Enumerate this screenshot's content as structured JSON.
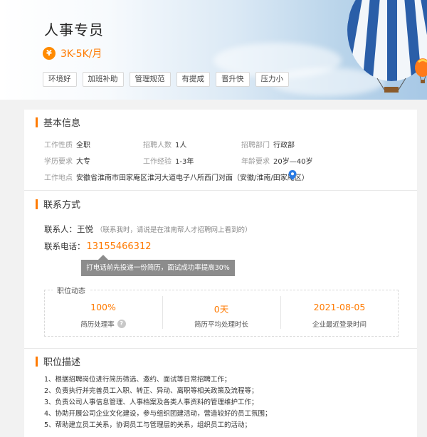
{
  "header": {
    "title": "人事专员",
    "salary_symbol": "¥",
    "salary": "3K-5K/月",
    "tags": [
      "环境好",
      "加班补助",
      "管理规范",
      "有提成",
      "晋升快",
      "压力小"
    ]
  },
  "basic_info": {
    "title": "基本信息",
    "fields": [
      {
        "label": "工作性质",
        "value": "全职"
      },
      {
        "label": "招聘人数",
        "value": "1人"
      },
      {
        "label": "招聘部门",
        "value": "行政部"
      },
      {
        "label": "学历要求",
        "value": "大专"
      },
      {
        "label": "工作经验",
        "value": "1-3年"
      },
      {
        "label": "年龄要求",
        "value": "20岁—40岁"
      }
    ],
    "location_label": "工作地点",
    "location_value": "安徽省淮南市田家庵区淮河大道电子八所西门对面（安徽/淮南/田家庵区）"
  },
  "contact": {
    "title": "联系方式",
    "person_label": "联系人：",
    "person_name": "王悦",
    "person_note": "（联系我时，请说是在淮南帮人才招聘网上看到的）",
    "phone_label": "联系电话：",
    "phone": "13155466312",
    "tooltip": "打电话前先投递一份简历，面试成功率提高30%"
  },
  "dynamics": {
    "title": "职位动态",
    "stats": [
      {
        "value": "100%",
        "label": "简历处理率"
      },
      {
        "value": "0天",
        "label": "简历平均处理时长"
      },
      {
        "value": "2021-08-05",
        "label": "企业最近登录时间"
      }
    ]
  },
  "description": {
    "title": "职位描述",
    "items": [
      "1、根据招聘岗位进行简历筛选、邀约、面试等日常招聘工作；",
      "2、负责执行并完善员工入职、转正、异动、离职等相关政策及流程等；",
      "3、负责公司人事信息管理、人事档案及各类人事资料的管理维护工作；",
      "4、协助开展公司企业文化建设，参与组织团建活动，营造较好的员工氛围；",
      "5、帮助建立员工关系，协调员工与管理层的关系，组织员工的活动；"
    ]
  },
  "colors": {
    "accent": "#ff7a00",
    "tooltip_bg": "#8c8c8c",
    "pin": "#2a7be4"
  }
}
